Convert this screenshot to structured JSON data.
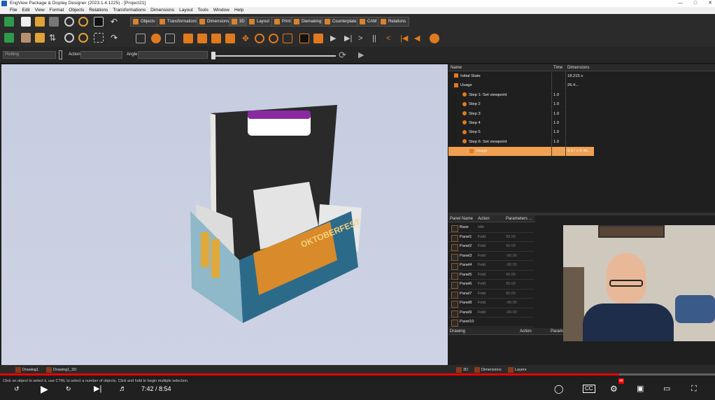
{
  "window": {
    "title": "EngView Package & Display Designer (2023.1.4.1225) - [Project21]"
  },
  "menu": [
    "File",
    "Edit",
    "View",
    "Format",
    "Objects",
    "Relations",
    "Transformations",
    "Dimensions",
    "Layout",
    "Tools",
    "Window",
    "Help"
  ],
  "mode_tabs": [
    "Objects",
    "Transformations",
    "Dimensions",
    "3D",
    "Layout",
    "Print",
    "Diemaking",
    "Counterplate",
    "CAM",
    "Relations"
  ],
  "toolbar3": {
    "dropdown1": "Plotting",
    "action_label": "Action",
    "angle_label": "Angle"
  },
  "steps_table": {
    "headers": [
      "Name",
      "Time",
      "Dimensions"
    ],
    "rows": [
      {
        "name": "Initial State",
        "time": "",
        "dim": "18.215 x 26.4..."
      },
      {
        "name": "Usage",
        "time": "",
        "dim": ""
      },
      {
        "name": "Step 1: Set viewpoint",
        "time": "1.0",
        "dim": ""
      },
      {
        "name": "Step 2",
        "time": "1.0",
        "dim": ""
      },
      {
        "name": "Step 3",
        "time": "1.0",
        "dim": ""
      },
      {
        "name": "Step 4",
        "time": "1.0",
        "dim": ""
      },
      {
        "name": "Step 5",
        "time": "1.0",
        "dim": ""
      },
      {
        "name": "Step 6: Set viewpoint",
        "time": "1.0",
        "dim": ""
      },
      {
        "name": "Usage",
        "time": "",
        "dim": "8.67 x 6.48..."
      }
    ]
  },
  "panel_table": {
    "headers": [
      "Panel Name",
      "Action",
      "Parameters ..."
    ],
    "rows": [
      {
        "name": "Base",
        "action": "Idle",
        "param": ""
      },
      {
        "name": "Panel1",
        "action": "Fold",
        "param": "90.00"
      },
      {
        "name": "Panel2",
        "action": "Fold",
        "param": "90.00"
      },
      {
        "name": "Panel3",
        "action": "Fold",
        "param": "-90.00"
      },
      {
        "name": "Panel4",
        "action": "Fold",
        "param": "-90.00"
      },
      {
        "name": "Panel5",
        "action": "Fold",
        "param": "90.00"
      },
      {
        "name": "Panel6",
        "action": "Fold",
        "param": "90.00"
      },
      {
        "name": "Panel7",
        "action": "Fold",
        "param": "90.00"
      },
      {
        "name": "Panel8",
        "action": "Fold",
        "param": "-90.00"
      },
      {
        "name": "Panel9",
        "action": "Fold",
        "param": "-90.00"
      },
      {
        "name": "Panel10",
        "action": "",
        "param": ""
      }
    ]
  },
  "drawing_table": {
    "headers": [
      "Drawing",
      "Action",
      "Parame"
    ]
  },
  "bottom_tabs": {
    "left": [
      "Drawing1",
      "Drawing1_3D"
    ],
    "right": [
      "3D",
      "Dimensions",
      "Layers"
    ]
  },
  "status": "Click on object to select it, use CTRL to select a number of objects. Click and hold to begin multiple selection.",
  "video": {
    "time": "7:42 / 8:54",
    "progress_fraction": 0.866,
    "badge": "4K"
  },
  "box_art_text": "OKTOBERFEST",
  "colors": {
    "accent": "#e07a1f",
    "selected_row": "#f0a050",
    "viewport": "#c9d0e2"
  }
}
